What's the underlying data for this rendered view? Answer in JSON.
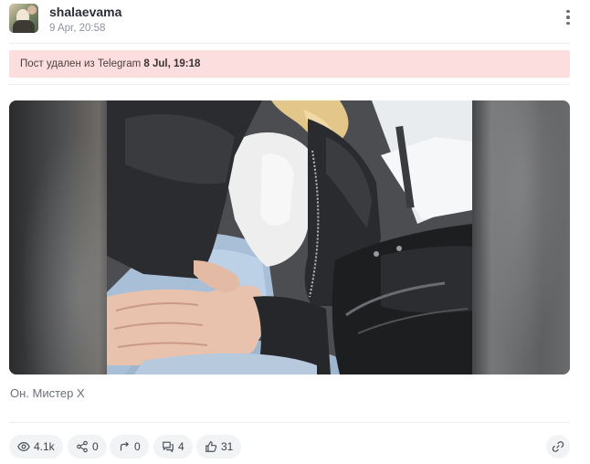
{
  "post": {
    "author": {
      "username": "shalaevama",
      "avatar_icon": "avatar-photo"
    },
    "timestamp": "9 Apr, 20:58",
    "menu_icon": "more-vertical-icon",
    "deleted_notice": {
      "prefix": "Пост удален из Telegram ",
      "date": "8 Jul, 19:18",
      "background": "#fcdedf"
    },
    "caption": "Он. Мистер Х",
    "stats": {
      "views": "4.1k",
      "shares": "0",
      "forwards": "0",
      "comments": "4",
      "likes": "31"
    },
    "link_icon": "link-icon"
  },
  "colors": {
    "chip_background": "#f1f3f5",
    "muted_text": "#8e939c",
    "separator": "#eceef1"
  }
}
